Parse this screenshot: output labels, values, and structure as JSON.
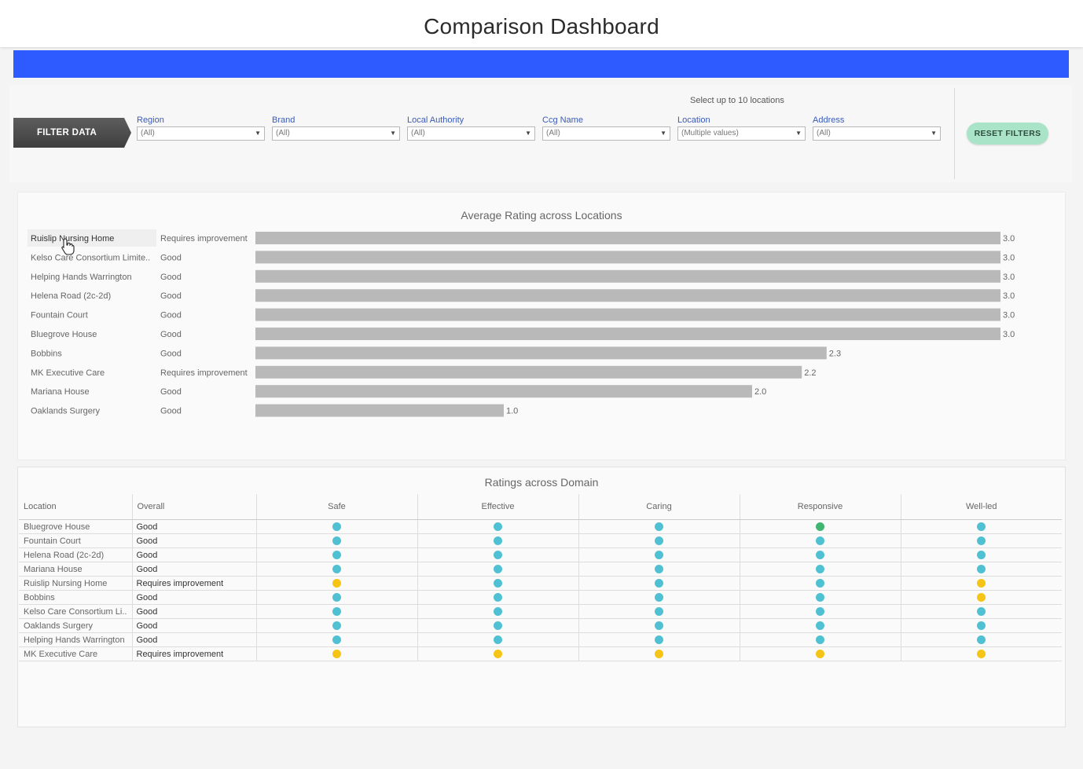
{
  "header": {
    "title": "Comparison Dashboard"
  },
  "colors": {
    "band": "#2e5bff",
    "bar": "#b9b9b9",
    "good": "#4fc1d3",
    "requires_improvement": "#f5c414",
    "outstanding": "#3fb56f"
  },
  "filters": {
    "tag_label": "FILTER DATA",
    "hint": "Select up to 10 locations",
    "fields": [
      {
        "label": "Region",
        "value": "(All)"
      },
      {
        "label": "Brand",
        "value": "(All)"
      },
      {
        "label": "Local Authority",
        "value": "(All)"
      },
      {
        "label": "Ccg Name",
        "value": "(All)"
      },
      {
        "label": "Location",
        "value": "(Multiple values)"
      },
      {
        "label": "Address",
        "value": "(All)"
      }
    ],
    "reset_label": "RESET FILTERS"
  },
  "chart_data": {
    "type": "bar",
    "orientation": "horizontal",
    "title": "Average Rating across Locations",
    "categories": [
      "Ruislip Nursing Home",
      "Kelso Care Consortium Limite..",
      "Helping Hands Warrington",
      "Helena Road (2c-2d)",
      "Fountain Court",
      "Bluegrove House",
      "Bobbins",
      "MK Executive Care",
      "Mariana House",
      "Oaklands Surgery"
    ],
    "overall": [
      "Requires improvement",
      "Good",
      "Good",
      "Good",
      "Good",
      "Good",
      "Good",
      "Requires improvement",
      "Good",
      "Good"
    ],
    "values": [
      3.0,
      3.0,
      3.0,
      3.0,
      3.0,
      3.0,
      2.3,
      2.2,
      2.0,
      1.0
    ],
    "value_labels": [
      "3.0",
      "3.0",
      "3.0",
      "3.0",
      "3.0",
      "3.0",
      "2.3",
      "2.2",
      "2.0",
      "1.0"
    ],
    "xlim": [
      0,
      3.0
    ],
    "grid": false,
    "legend": "none"
  },
  "domain_table": {
    "title": "Ratings across Domain",
    "columns": [
      "Location",
      "Overall",
      "Safe",
      "Effective",
      "Caring",
      "Responsive",
      "Well-led"
    ],
    "rows": [
      {
        "location": "Bluegrove House",
        "overall": "Good",
        "ratings": [
          "good",
          "good",
          "good",
          "outstanding",
          "good"
        ]
      },
      {
        "location": "Fountain Court",
        "overall": "Good",
        "ratings": [
          "good",
          "good",
          "good",
          "good",
          "good"
        ]
      },
      {
        "location": "Helena Road (2c-2d)",
        "overall": "Good",
        "ratings": [
          "good",
          "good",
          "good",
          "good",
          "good"
        ]
      },
      {
        "location": "Mariana House",
        "overall": "Good",
        "ratings": [
          "good",
          "good",
          "good",
          "good",
          "good"
        ]
      },
      {
        "location": "Ruislip Nursing Home",
        "overall": "Requires improvement",
        "ratings": [
          "requires_improvement",
          "good",
          "good",
          "good",
          "requires_improvement"
        ]
      },
      {
        "location": "Bobbins",
        "overall": "Good",
        "ratings": [
          "good",
          "good",
          "good",
          "good",
          "requires_improvement"
        ]
      },
      {
        "location": "Kelso Care Consortium Li..",
        "overall": "Good",
        "ratings": [
          "good",
          "good",
          "good",
          "good",
          "good"
        ]
      },
      {
        "location": "Oaklands Surgery",
        "overall": "Good",
        "ratings": [
          "good",
          "good",
          "good",
          "good",
          "good"
        ]
      },
      {
        "location": "Helping Hands Warrington",
        "overall": "Good",
        "ratings": [
          "good",
          "good",
          "good",
          "good",
          "good"
        ]
      },
      {
        "location": "MK Executive Care",
        "overall": "Requires improvement",
        "ratings": [
          "requires_improvement",
          "requires_improvement",
          "requires_improvement",
          "requires_improvement",
          "requires_improvement"
        ]
      }
    ]
  }
}
